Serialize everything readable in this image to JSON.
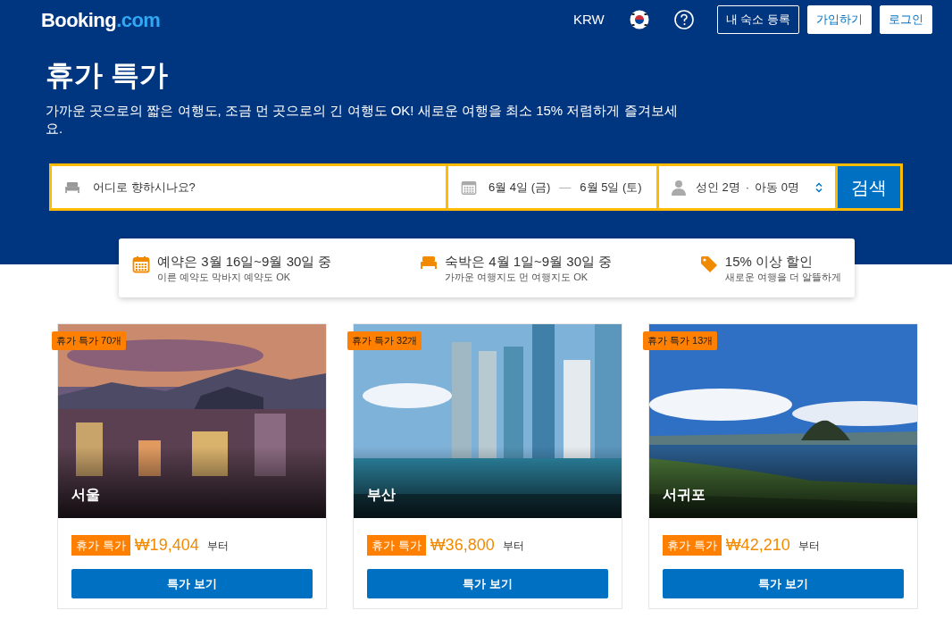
{
  "header": {
    "logo": {
      "name": "Booking",
      "suffix": ".com"
    },
    "currency": "KRW",
    "buttons": [
      "내 숙소 등록",
      "가입하기",
      "로그인"
    ]
  },
  "hero": {
    "title": "휴가 특가",
    "description": "가까운 곳으로의 짧은 여행도, 조금 먼 곳으로의 긴 여행도 OK! 새로운 여행을 최소 15% 저렴하게 즐겨보세요."
  },
  "search": {
    "destination_placeholder": "어디로 향하시나요?",
    "check_in": "6월 4일 (금)",
    "separator": "—",
    "check_out": "6월 5일 (토)",
    "adults": "성인 2명",
    "dot": "·",
    "children": "아동 0명",
    "button": "검색"
  },
  "benefits": [
    {
      "kind": "calendar",
      "title": "예약은 3월 16일~9월 30일 중",
      "subtitle": "이른 예약도 막바지 예약도 OK"
    },
    {
      "kind": "bed",
      "title": "숙박은 4월 1일~9월 30일 중",
      "subtitle": "가까운 여행지도 먼 여행지도 OK"
    },
    {
      "kind": "tag",
      "title": "15% 이상 할인",
      "subtitle": "새로운 여행을 더 알뜰하게"
    }
  ],
  "destinations": [
    {
      "badge": "휴가 특가 70개",
      "city": "서울",
      "deal_label": "휴가 특가",
      "price": "₩19,404",
      "suffix": "부터",
      "button": "특가 보기"
    },
    {
      "badge": "휴가 특가 32개",
      "city": "부산",
      "deal_label": "휴가 특가",
      "price": "₩36,800",
      "suffix": "부터",
      "button": "특가 보기"
    },
    {
      "badge": "휴가 특가 13개",
      "city": "서귀포",
      "deal_label": "휴가 특가",
      "price": "₩42,210",
      "suffix": "부터",
      "button": "특가 보기"
    }
  ]
}
